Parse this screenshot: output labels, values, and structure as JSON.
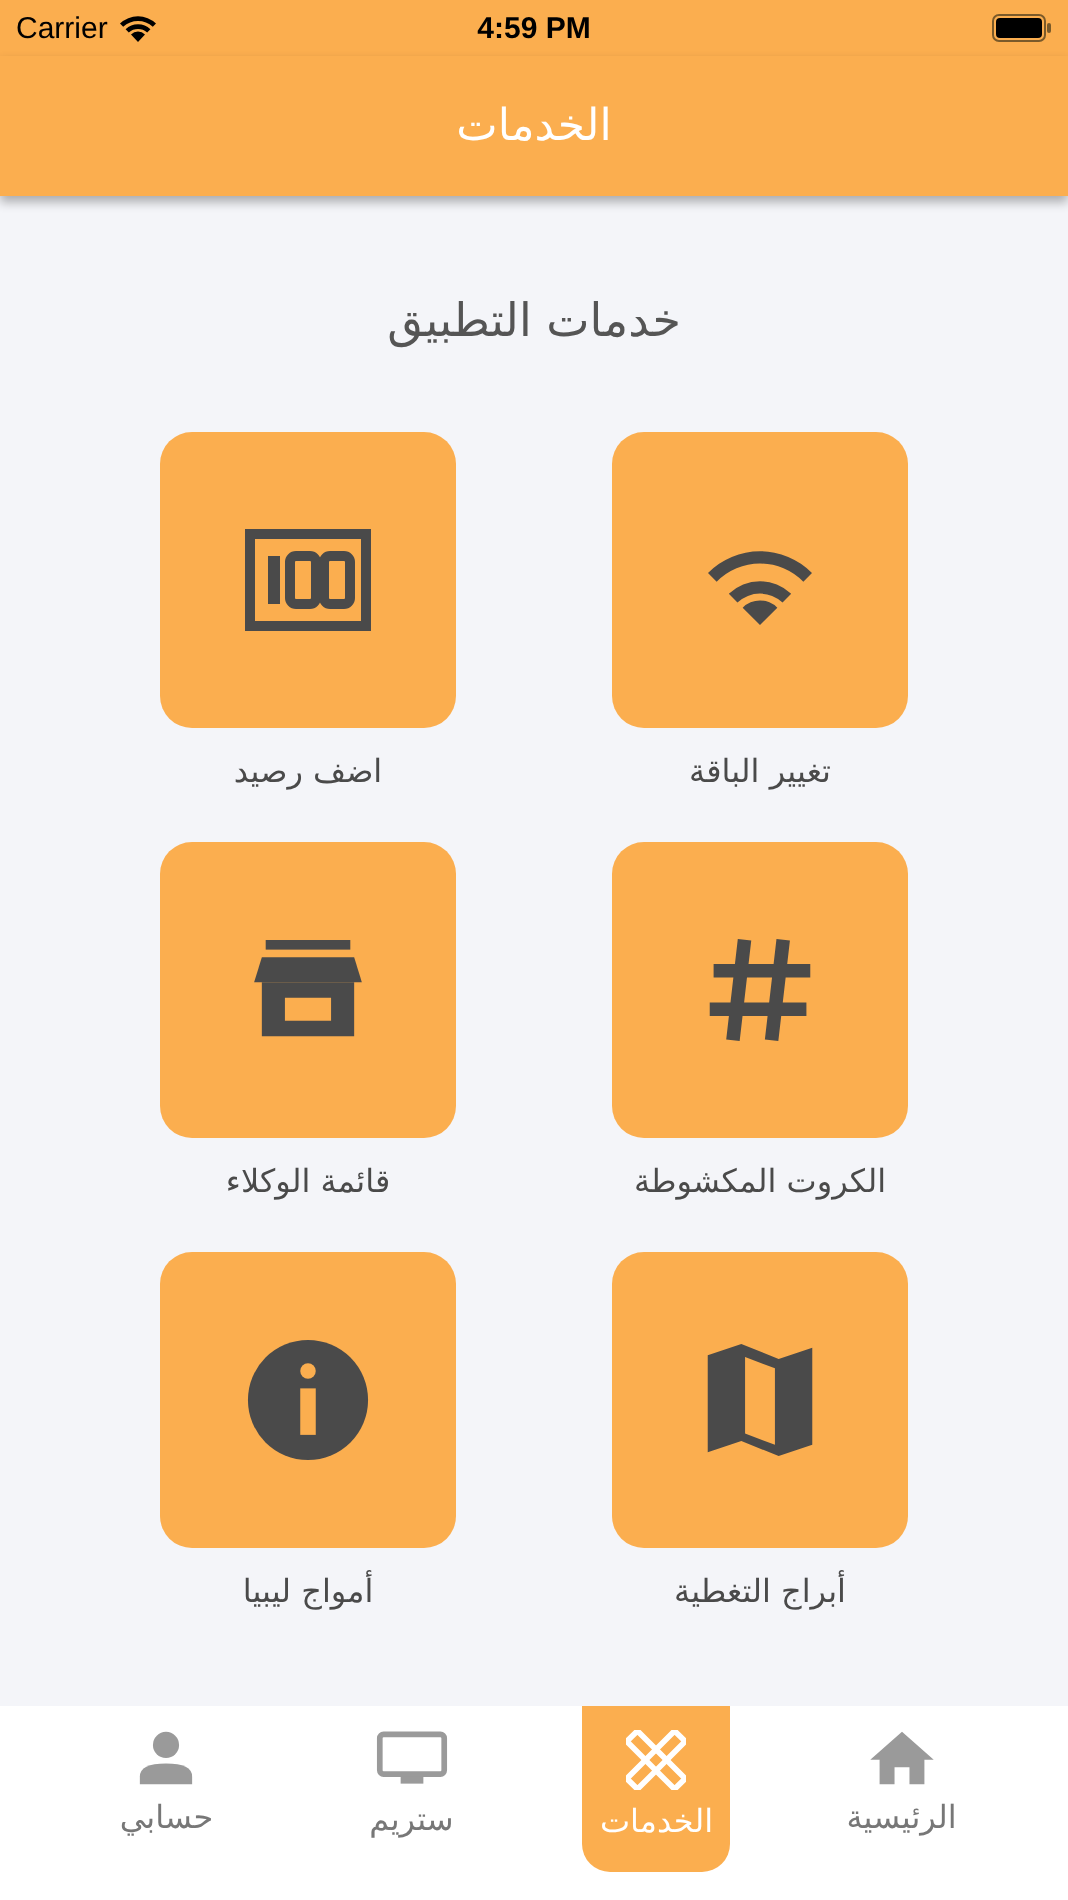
{
  "status_bar": {
    "carrier": "Carrier",
    "time": "4:59 PM"
  },
  "nav_bar": {
    "title": "الخدمات"
  },
  "section_title": "خدمات التطبيق",
  "services": [
    {
      "label": "تغيير الباقة"
    },
    {
      "label": "اضف رصيد"
    },
    {
      "label": "الكروت المكشوطة"
    },
    {
      "label": "قائمة الوكلاء"
    },
    {
      "label": "أبراج التغطية"
    },
    {
      "label": "أمواج ليبيا"
    }
  ],
  "tabs": [
    {
      "label": "الرئيسية",
      "selected": false
    },
    {
      "label": "الخدمات",
      "selected": true
    },
    {
      "label": "ستريم",
      "selected": false
    },
    {
      "label": "حسابي",
      "selected": false
    }
  ]
}
